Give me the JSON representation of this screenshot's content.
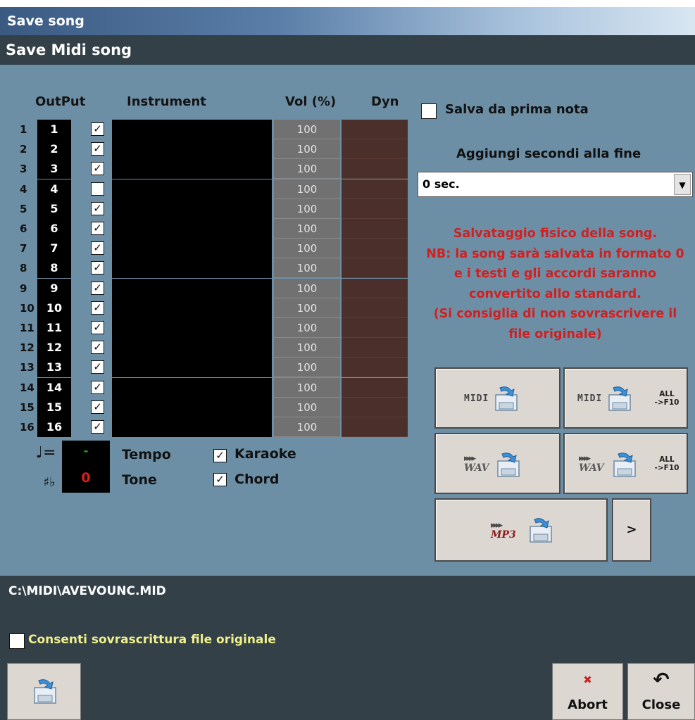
{
  "window": {
    "title": "Save song",
    "header": "Save Midi song"
  },
  "columns": {
    "output": "OutPut",
    "instrument": "Instrument",
    "volume": "Vol (%)",
    "dyn": "Dyn"
  },
  "tracks": [
    {
      "num": "1",
      "output": "1",
      "checked": true,
      "volume": "100"
    },
    {
      "num": "2",
      "output": "2",
      "checked": true,
      "volume": "100"
    },
    {
      "num": "3",
      "output": "3",
      "checked": true,
      "volume": "100"
    },
    {
      "num": "4",
      "output": "4",
      "checked": false,
      "volume": "100"
    },
    {
      "num": "5",
      "output": "5",
      "checked": true,
      "volume": "100"
    },
    {
      "num": "6",
      "output": "6",
      "checked": true,
      "volume": "100"
    },
    {
      "num": "7",
      "output": "7",
      "checked": true,
      "volume": "100"
    },
    {
      "num": "8",
      "output": "8",
      "checked": true,
      "volume": "100"
    },
    {
      "num": "9",
      "output": "9",
      "checked": true,
      "volume": "100"
    },
    {
      "num": "10",
      "output": "10",
      "checked": true,
      "volume": "100"
    },
    {
      "num": "11",
      "output": "11",
      "checked": true,
      "volume": "100"
    },
    {
      "num": "12",
      "output": "12",
      "checked": true,
      "volume": "100"
    },
    {
      "num": "13",
      "output": "13",
      "checked": true,
      "volume": "100"
    },
    {
      "num": "14",
      "output": "14",
      "checked": true,
      "volume": "100"
    },
    {
      "num": "15",
      "output": "15",
      "checked": true,
      "volume": "100"
    },
    {
      "num": "16",
      "output": "16",
      "checked": true,
      "volume": "100"
    }
  ],
  "tempo": {
    "symbol": "♩=",
    "value": "-",
    "label": "Tempo"
  },
  "tone": {
    "symbol": "♯♭",
    "value": "0",
    "label": "Tone"
  },
  "options": {
    "karaoke": {
      "label": "Karaoke",
      "checked": true
    },
    "chord": {
      "label": "Chord",
      "checked": true
    },
    "save_from_first_note": {
      "label": "Salva da prima nota",
      "checked": false
    }
  },
  "add_seconds": {
    "label": "Aggiungi secondi alla fine",
    "value": "0 sec."
  },
  "note_lines": [
    "Salvataggio fisico della song.",
    "NB: la song sarà salvata in formato 0",
    "e i testi e gli accordi saranno",
    "convertito allo standard.",
    "(Si consiglia di non sovrascrivere il",
    "file originale)"
  ],
  "save_buttons": {
    "midi_text": "MIDI",
    "wav_text": "WAV",
    "mp3_text": "MP3",
    "arrows_text": "▸▸▸▸",
    "all_line1": "ALL",
    "all_line2": "->F10",
    "more_label": ">"
  },
  "file_path": "C:\\MIDI\\AVEVOUNC.MID",
  "allow_overwrite": {
    "label": "Consenti sovrascrittura file originale",
    "checked": false
  },
  "bottom": {
    "abort_label": "Abort",
    "close_label": "Close"
  },
  "colors": {
    "panel": "#6d8fa6",
    "dark": "#334048",
    "warning": "#d21f1f",
    "highlight": "#f0f08a"
  }
}
